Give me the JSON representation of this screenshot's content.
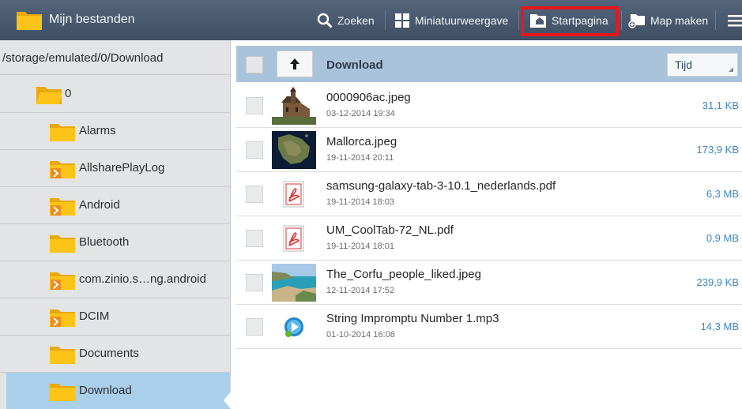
{
  "app": {
    "title": "Mijn bestanden"
  },
  "toolbar": {
    "search_label": "Zoeken",
    "thumbnail_view_label": "Miniatuurweergave",
    "home_label": "Startpagina",
    "new_folder_label": "Map maken",
    "highlight_color": "#e8161c"
  },
  "sidebar": {
    "path": "/storage/emulated/0/Download",
    "folders": [
      {
        "label": "0",
        "icon": "folder-open-icon"
      },
      {
        "label": "Alarms",
        "icon": "folder-icon"
      },
      {
        "label": "AllsharePlayLog",
        "icon": "folder-expand-icon"
      },
      {
        "label": "Android",
        "icon": "folder-expand-icon"
      },
      {
        "label": "Bluetooth",
        "icon": "folder-icon"
      },
      {
        "label": "com.zinio.s…ng.android",
        "icon": "folder-expand-icon"
      },
      {
        "label": "DCIM",
        "icon": "folder-expand-icon"
      },
      {
        "label": "Documents",
        "icon": "folder-icon"
      },
      {
        "label": "Download",
        "icon": "folder-icon",
        "selected": true
      }
    ]
  },
  "list": {
    "header_title": "Download",
    "sort_value": "Tijd",
    "files": [
      {
        "name": "0000906ac.jpeg",
        "date": "03-12-2014 19:34",
        "size": "31,1 KB",
        "thumb": "church-photo"
      },
      {
        "name": "Mallorca.jpeg",
        "date": "19-11-2014 20:11",
        "size": "173,9 KB",
        "thumb": "island-map-photo"
      },
      {
        "name": "samsung-galaxy-tab-3-10.1_nederlands.pdf",
        "date": "19-11-2014 18:03",
        "size": "6,3 MB",
        "thumb": "pdf-icon"
      },
      {
        "name": "UM_CoolTab-72_NL.pdf",
        "date": "19-11-2014 18:01",
        "size": "0,9 MB",
        "thumb": "pdf-icon"
      },
      {
        "name": "The_Corfu_people_liked.jpeg",
        "date": "12-11-2014 17:52",
        "size": "239,9 KB",
        "thumb": "coast-photo"
      },
      {
        "name": "String Impromptu Number 1.mp3",
        "date": "01-10-2014 16:08",
        "size": "14,3 MB",
        "thumb": "music-icon"
      }
    ]
  },
  "colors": {
    "actionbar": "#4a5a70",
    "list_header": "#a9c3da",
    "selected_folder": "#a9cfea",
    "size_text": "#3a87c6",
    "folder_yellow": "#f6c417"
  }
}
